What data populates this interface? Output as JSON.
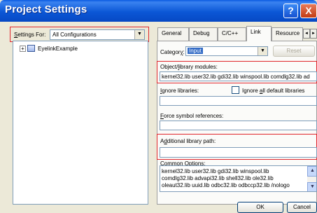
{
  "window": {
    "title": "Project Settings",
    "help": "?",
    "close": "X"
  },
  "left": {
    "settings_for_label": "Settings For:",
    "settings_for_value": "All Configurations",
    "tree_item": "EyelinkExample"
  },
  "tabs": [
    "General",
    "Debug",
    "C/C++",
    "Link",
    "Resource"
  ],
  "active_tab": "Link",
  "link": {
    "category_label": "Category:",
    "category_value": "Input",
    "reset_label": "Reset",
    "object_modules_label": "Object/library modules:",
    "object_modules_value": "kernel32.lib user32.lib gdi32.lib winspool.lib comdlg32.lib ad",
    "ignore_libraries_label": "Ignore libraries:",
    "ignore_all_label": "Ignore all default libraries",
    "ignore_all_checked": false,
    "force_symbol_label": "Force symbol references:",
    "additional_path_label": "Additional library path:",
    "common_options_label": "Common Options:",
    "common_options_lines": [
      "kernel32.lib user32.lib gdi32.lib winspool.lib",
      "comdlg32.lib advapi32.lib shell32.lib ole32.lib",
      "oleaut32.lib uuid.lib odbc32.lib odbccp32.lib /nologo"
    ]
  },
  "footer": {
    "ok": "OK",
    "cancel": "Cancel"
  }
}
